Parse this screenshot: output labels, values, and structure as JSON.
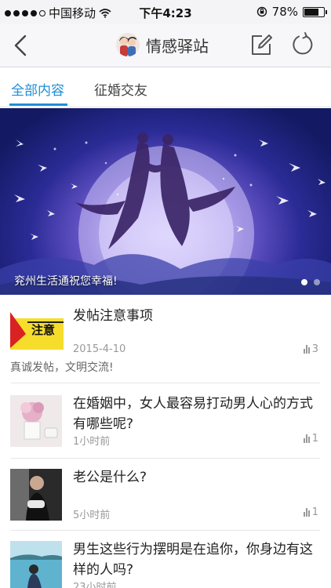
{
  "status_bar": {
    "carrier": "中国移动",
    "time": "下午4:23",
    "battery_text": "78%",
    "battery_level": 0.78
  },
  "nav": {
    "title": "情感驿站",
    "icons": [
      "back-chevron-icon",
      "couple-avatar",
      "edit-icon",
      "refresh-icon"
    ]
  },
  "tabs": [
    {
      "label": "全部内容",
      "active": true
    },
    {
      "label": "征婚交友",
      "active": false
    }
  ],
  "banner": {
    "caption": "兖州生活通祝您幸福!",
    "pages": 2,
    "current_page": 1
  },
  "posts": [
    {
      "title": "发帖注意事项",
      "meta": "2015-4-10",
      "count": "3",
      "thumb_text": "注意",
      "subtitle": "真诚发帖，文明交流!"
    },
    {
      "title": "在婚姻中，女人最容易打动男人心的方式有哪些呢?",
      "meta": "1小时前",
      "count": "1"
    },
    {
      "title": "老公是什么?",
      "meta": "5小时前",
      "count": "1"
    },
    {
      "title": "男生这些行为摆明是在追你，你身边有这样的人吗?",
      "meta": "23小时前",
      "count": ""
    }
  ],
  "colors": {
    "accent": "#1c8fd8",
    "status_bg": "#f4f4f6",
    "nav_bg": "#f7f7f9"
  }
}
